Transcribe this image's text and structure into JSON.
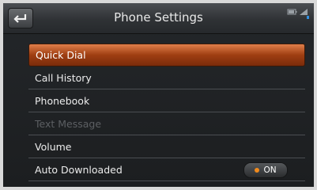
{
  "header": {
    "title": "Phone Settings",
    "back_icon": "back-arrow-icon",
    "status_icon": "battery-signal-icon"
  },
  "menu": {
    "items": [
      {
        "label": "Quick Dial",
        "state": "selected"
      },
      {
        "label": "Call History",
        "state": "enabled"
      },
      {
        "label": "Phonebook",
        "state": "enabled"
      },
      {
        "label": "Text Message",
        "state": "disabled"
      },
      {
        "label": "Volume",
        "state": "enabled"
      },
      {
        "label": "Auto Downloaded",
        "state": "enabled",
        "toggle": "ON"
      }
    ]
  },
  "colors": {
    "selected_highlight": "#b24a18",
    "toggle_indicator": "#f08a1c",
    "disabled_text": "#5c5f63"
  }
}
